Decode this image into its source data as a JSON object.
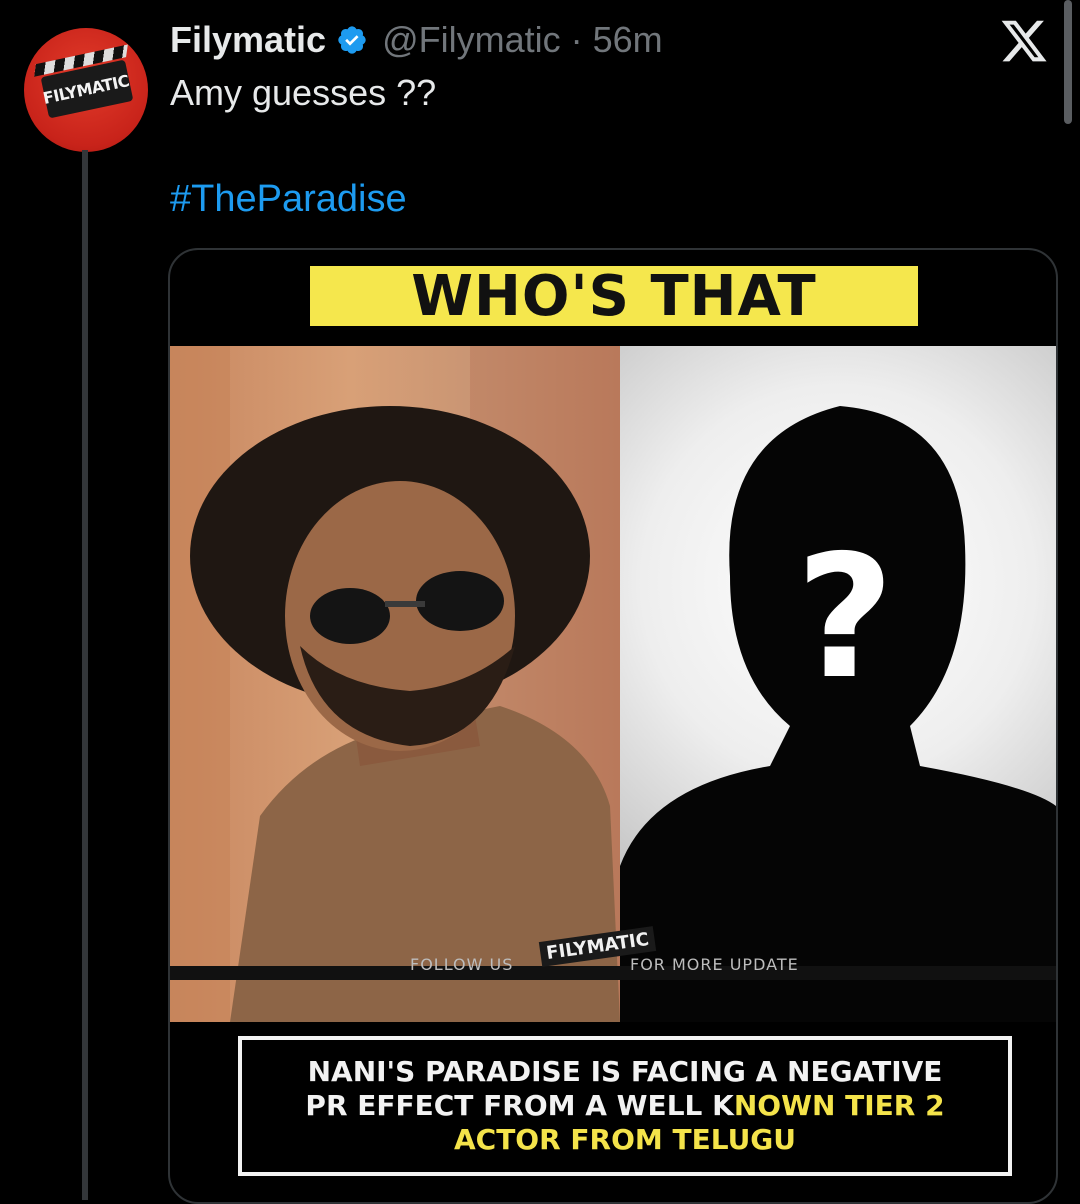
{
  "account": {
    "display_name": "Filymatic",
    "handle": "@Filymatic",
    "separator": "·",
    "time": "56m",
    "avatar_text": "FILYMATIC"
  },
  "tweet": {
    "text": "Amy guesses ??",
    "hashtag": "#TheParadise"
  },
  "media": {
    "banner": "WHO'S THAT",
    "follow_text": "FOLLOW US",
    "logo_text": "FILYMATIC",
    "more_text": "FOR MORE UPDATE",
    "question_mark": "?",
    "caption_line1": "NANI'S PARADISE IS FACING A NEGATIVE",
    "caption_line2_white": "PR EFFECT FROM A WELL K",
    "caption_line2_yellow": "NOWN TIER 2",
    "caption_line3": "ACTOR FROM TELUGU"
  },
  "colors": {
    "background": "#000000",
    "link": "#1d9bf0",
    "handle_gray": "#71767b",
    "banner_yellow": "#f5e74d",
    "caption_yellow": "#f4e34a",
    "verified_blue": "#1d9bf0"
  },
  "icons": {
    "verified": "verified-badge-icon",
    "x_logo": "x-logo-icon"
  }
}
